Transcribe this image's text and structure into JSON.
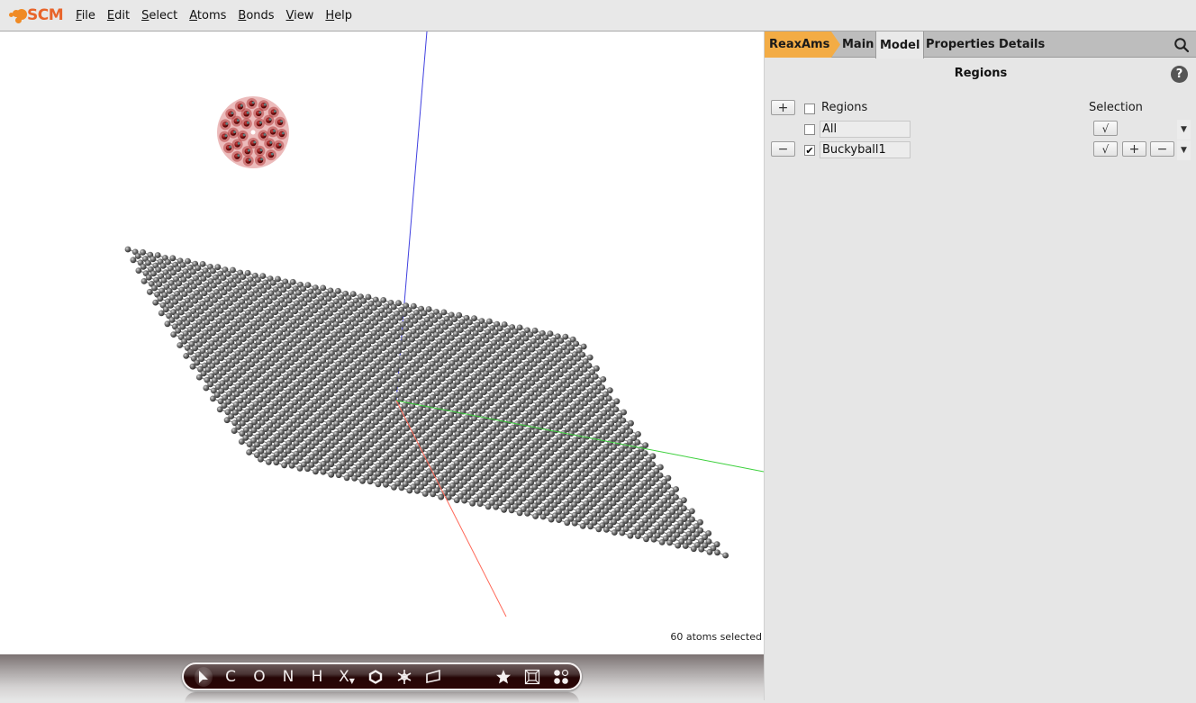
{
  "app": {
    "logo_text": "SCM",
    "brand_color": "#e8642a"
  },
  "menu": {
    "items": [
      {
        "label": "File",
        "accel": "F",
        "rest": "ile"
      },
      {
        "label": "Edit",
        "accel": "E",
        "rest": "dit"
      },
      {
        "label": "Select",
        "accel": "S",
        "rest": "elect"
      },
      {
        "label": "Atoms",
        "accel": "A",
        "rest": "toms"
      },
      {
        "label": "Bonds",
        "accel": "B",
        "rest": "onds"
      },
      {
        "label": "View",
        "accel": "V",
        "rest": "iew"
      },
      {
        "label": "Help",
        "accel": "H",
        "rest": "elp"
      }
    ]
  },
  "viewport": {
    "status": "60 atoms selected",
    "molecules": [
      {
        "name": "Buckyball1",
        "type": "fullerene",
        "atom_color": "#8b1a1a",
        "selected": true
      },
      {
        "name": "graphene-sheet",
        "type": "graphene",
        "atom_color": "#777777",
        "selected": false
      }
    ],
    "axes": {
      "x_color": "#ff6a5a",
      "y_color": "#3cd03c",
      "z_color": "#4040e0"
    }
  },
  "toolbar": {
    "tools": [
      {
        "name": "select-tool",
        "glyph": "arrow-icon"
      },
      {
        "name": "carbon-tool",
        "glyph": "C"
      },
      {
        "name": "oxygen-tool",
        "glyph": "O"
      },
      {
        "name": "nitrogen-tool",
        "glyph": "N"
      },
      {
        "name": "hydrogen-tool",
        "glyph": "H"
      },
      {
        "name": "other-element-tool",
        "glyph": "X"
      },
      {
        "name": "ring-tool",
        "glyph": "hexagon-icon"
      },
      {
        "name": "structure-tool",
        "glyph": "snowflake-icon"
      },
      {
        "name": "plane-tool",
        "glyph": "plane-icon"
      },
      {
        "name": "favorites-tool",
        "glyph": "star-icon"
      },
      {
        "name": "crystal-tool",
        "glyph": "box-icon"
      },
      {
        "name": "molecules-tool",
        "glyph": "dots-icon"
      }
    ]
  },
  "panel": {
    "tabs": [
      {
        "label": "ReaxAms",
        "active": false
      },
      {
        "label": "Main",
        "active": false
      },
      {
        "label": "Model",
        "active": true
      },
      {
        "label": "Properties",
        "active": false
      },
      {
        "label": "Details",
        "active": false
      }
    ],
    "title": "Regions",
    "help_label": "?",
    "regions": {
      "header_label": "Regions",
      "header_checked": false,
      "selection_header": "Selection",
      "add_label": "+",
      "remove_label": "−",
      "check_label": "√",
      "plus_label": "+",
      "minus_label": "−",
      "dropdown_arrow": "▼",
      "rows": [
        {
          "name": "All",
          "checked": false,
          "check_mark": ""
        },
        {
          "name": "Buckyball1",
          "checked": true,
          "check_mark": "✔"
        }
      ]
    }
  }
}
